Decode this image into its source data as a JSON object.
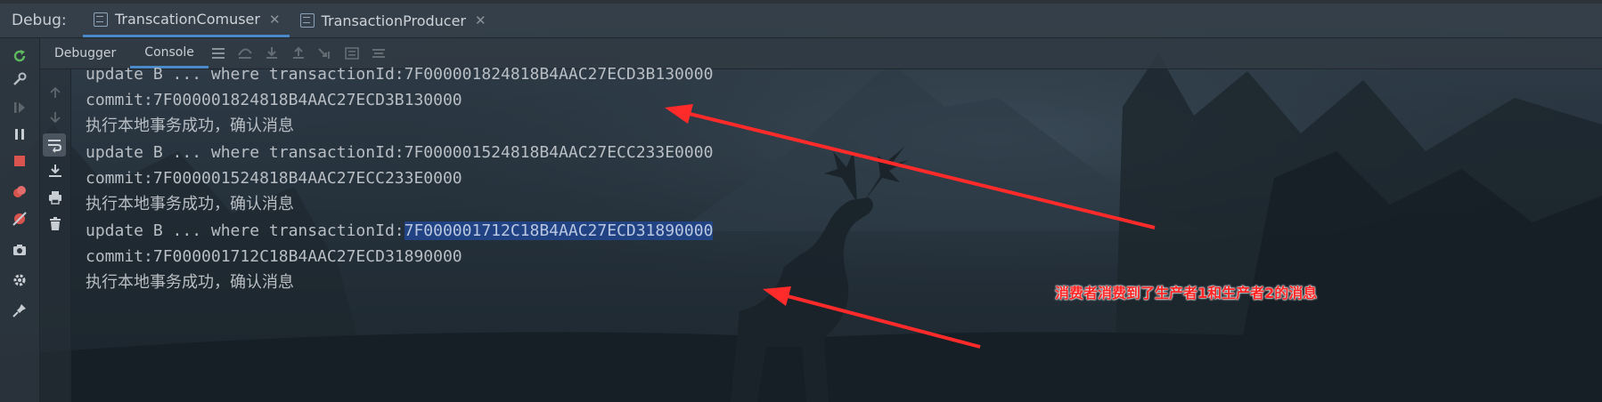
{
  "window": {
    "debug_label": "Debug:",
    "tabs": [
      {
        "label": "TranscationComuser",
        "active": true
      },
      {
        "label": "TransactionProducer",
        "active": false
      }
    ]
  },
  "inner_tabs": [
    {
      "label": "Debugger",
      "active": false
    },
    {
      "label": "Console",
      "active": true
    }
  ],
  "console": {
    "lines": [
      {
        "prefix": "update B ... where transactionId:",
        "value": "7F000001824818B4AAC27ECD3B130000"
      },
      {
        "prefix": "commit:",
        "value": "7F000001824818B4AAC27ECD3B130000"
      },
      {
        "prefix": "执行本地事务成功，确认消息",
        "value": ""
      },
      {
        "prefix": "update B ... where transactionId:",
        "value": "7F000001524818B4AAC27ECC233E0000"
      },
      {
        "prefix": "commit:",
        "value": "7F000001524818B4AAC27ECC233E0000"
      },
      {
        "prefix": "执行本地事务成功，确认消息",
        "value": ""
      },
      {
        "prefix": "update B ... where transactionId:",
        "value": "7F000001712C18B4AAC27ECD31890000",
        "highlighted": true
      },
      {
        "prefix": "commit:",
        "value": "7F000001712C18B4AAC27ECD31890000"
      },
      {
        "prefix": "执行本地事务成功，确认消息",
        "value": ""
      }
    ]
  },
  "annotation": {
    "text": "消费者消费到了生产者1和生产者2的消息",
    "color": "#ff2424"
  },
  "colors": {
    "accent": "#4a88c7",
    "selection": "#214283",
    "rerun": "#5fb85f",
    "stop": "#d9534f"
  }
}
